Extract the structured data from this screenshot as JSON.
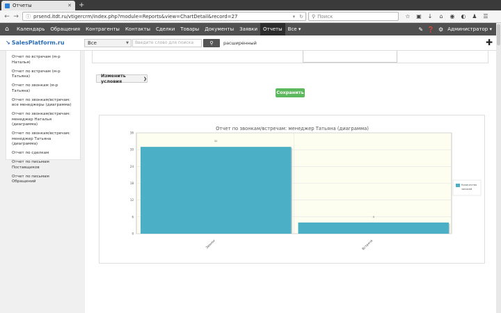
{
  "browser": {
    "tab_title": "Отчеты",
    "url": "prsend.itdt.ru/vtigercrm/index.php?module=Reports&view=ChartDetail&record=27",
    "search_placeholder": "Поиск"
  },
  "menu": {
    "items": [
      "Календарь",
      "Обращения",
      "Контрагенты",
      "Контакты",
      "Сделки",
      "Товары",
      "Документы",
      "Заявки",
      "Отчеты",
      "Все"
    ],
    "active_index": 8,
    "user": "Администратор"
  },
  "toolbar": {
    "logo": "SalesPlatform.ru",
    "select_value": "Все",
    "search_placeholder": "Введите слово для поиска",
    "advanced_label": "расширенный"
  },
  "sidebar": {
    "items": [
      "Отчет по встречам (м-р Наталья)",
      "Отчет по встречам (м-р Татьяна)",
      "Отчет по звонкам (м-р Татьяна)",
      "Отчет по звонкам/встречам: все менеджеры (диаграмма)",
      "Отчет по звонкам/встречам: менеджер Наталья (диаграмма)",
      "Отчет по звонкам/встречам: менеджер Татьяна (диаграмма)",
      "Отчет по сделкам",
      "Отчет по письмам Поставщиков",
      "Отчет по письмам Обращений"
    ]
  },
  "actions": {
    "change_conditions": "Изменить условия",
    "save": "Сохранить"
  },
  "colors": {
    "bar": "#4bafc5",
    "save": "#5cb85c",
    "menu_bg": "#505050",
    "plot_bg": "#fdfdf0"
  },
  "chart_data": {
    "type": "bar",
    "title": "Отчет по звонкам/встречам: менеджер Татьяна (диаграмма)",
    "categories": [
      "Звонок",
      "Встреча"
    ],
    "series": [
      {
        "name": "Количество записей",
        "values": [
          31,
          4
        ]
      }
    ],
    "data_labels": [
      "31",
      "4"
    ],
    "y_ticks": [
      "0",
      "6",
      "12",
      "18",
      "24",
      "30",
      "36"
    ],
    "ylim": [
      0,
      36
    ],
    "grid": true,
    "legend_position": "right",
    "legend_label_lines": [
      "Количество",
      "записей"
    ]
  }
}
